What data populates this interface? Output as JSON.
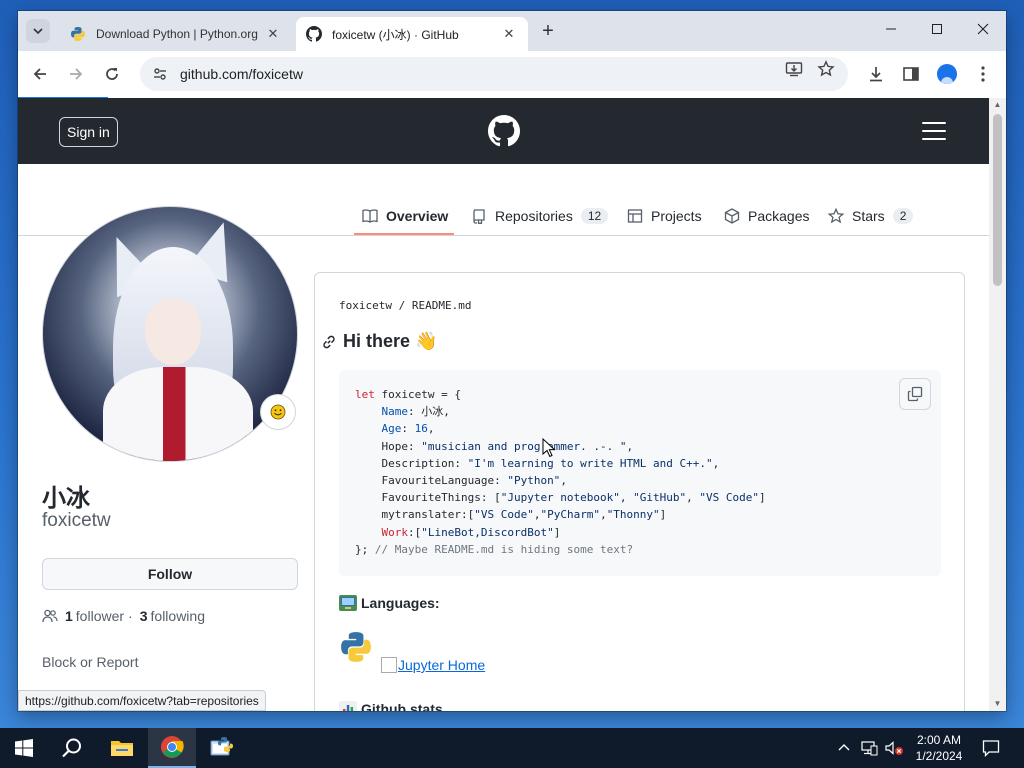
{
  "browser": {
    "tabs": [
      {
        "title": "Download Python | Python.org",
        "active": false
      },
      {
        "title": "foxicetw (小冰) · GitHub",
        "active": true
      }
    ],
    "url": "github.com/foxicetw",
    "status_url": "https://github.com/foxicetw?tab=repositories"
  },
  "github": {
    "sign_in_label": "Sign in",
    "tabs": [
      {
        "label": "Overview",
        "count": ""
      },
      {
        "label": "Repositories",
        "count": "12"
      },
      {
        "label": "Projects",
        "count": ""
      },
      {
        "label": "Packages",
        "count": ""
      },
      {
        "label": "Stars",
        "count": "2"
      }
    ],
    "profile": {
      "name": "小冰",
      "login": "foxicetw",
      "follow_label": "Follow",
      "followers_count": "1",
      "followers_label": "follower",
      "separator": "·",
      "following_count": "3",
      "following_label": "following",
      "block_label": "Block or Report"
    },
    "readme": {
      "path": "foxicetw / README.md",
      "heading": "Hi there 👋",
      "code_lines": [
        "let foxicetw = {",
        "    Name: 小冰,",
        "    Age: 16,",
        "    Hope: \"musician and programmer. .-. \",",
        "    Description: \"I'm learning to write HTML and C++.\",",
        "    FavouriteLanguage: \"Python\",",
        "    FavouriteThings: [\"Jupyter notebook\", \"GitHub\", \"VS Code\"]",
        "    mytranslater:[\"VS Code\",\"PyCharm\",\"Thonny\"]",
        "    Work:[\"LineBot,DiscordBot\"]",
        "}; // Maybe README.md is hiding some text?"
      ],
      "languages_heading": "Languages:",
      "jupyter_link": "Jupyter Home",
      "stats_heading": "Github stats"
    }
  },
  "taskbar": {
    "time": "2:00 AM",
    "date": "1/2/2024"
  },
  "colors": {
    "github_header": "#24292f",
    "accent_link": "#0969da",
    "tab_underline": "#fd8c73"
  }
}
